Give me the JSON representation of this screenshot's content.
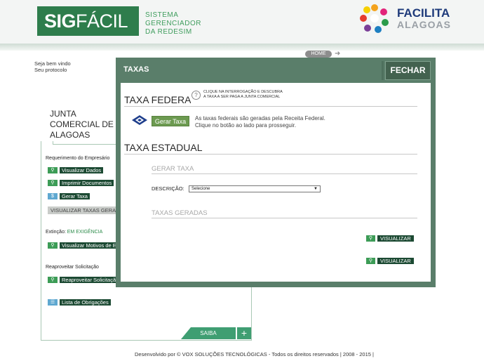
{
  "header": {
    "logo_bold": "SIG",
    "logo_light": "FÁCIL",
    "tagline_1": "SISTEMA GERENCIADOR",
    "tagline_2": "DA REDESIM",
    "partner_line1": "FACILITA",
    "partner_line2": "ALAGOAS"
  },
  "nav": {
    "welcome": "Seja bem vindo",
    "protocol": "Seu protocolo",
    "home_label": "HOME"
  },
  "main": {
    "org_title": "JUNTA COMERCIAL DE ALAGOAS",
    "sections": {
      "requerimento": "Requerimento do Empresário",
      "extincao_label": "Extinção:",
      "extincao_status": "EM EXIGÊNCIA",
      "reaproveitar": "Reaproveitar Solicitação"
    },
    "buttons": {
      "visualizar_dados": "Visualizar Dados",
      "imprimir_documentos": "Imprimir Documentos",
      "gerar_taxa": "Gerar Taxa",
      "visualizar_taxas": "VISUALIZAR TAXAS GERADAS",
      "visualizar_motivos": "Visualizar Motivos de Exigência",
      "reaproveitar": "Reaproveitar Solicitação",
      "lista_obrigacoes": "Lista de Obrigações"
    },
    "saiba": "SAIBA",
    "plus": "+"
  },
  "footer": "Desenvolvido por © VOX SOLUÇÕES TECNOLÓGICAS - Todos os direitos reservados | 2008 - 2015 |",
  "modal": {
    "title": "TAXAS",
    "close": "FECHAR",
    "taxa_federal": "TAXA FEDERAL",
    "help_q": "?",
    "help_1": "CLIQUE NA INTERROGAÇÃO E DESCUBRA",
    "help_2": "A TAXA A SER PAGA A JUNTA COMERCIAL",
    "gerar_taxa": "Gerar Taxa",
    "rf_text_1": "As taxas federais são geradas pela Receita Federal.",
    "rf_text_2": "Clique no botão ao lado para prosseguir.",
    "taxa_estadual": "TAXA ESTADUAL",
    "gerar_taxa_head": "GERAR TAXA",
    "descricao_label": "DESCRIÇÃO:",
    "descricao_value": "Selecione",
    "taxas_geradas_head": "TAXAS GERADAS",
    "visualizar_1": "VISUALIZAR",
    "visualizar_2": "VISUALIZAR"
  },
  "colors": {
    "brand_green": "#2e7d4c",
    "modal_frame": "#5a7e6a",
    "dark_button": "#1c4a33",
    "icon_green": "#3c9c56"
  }
}
